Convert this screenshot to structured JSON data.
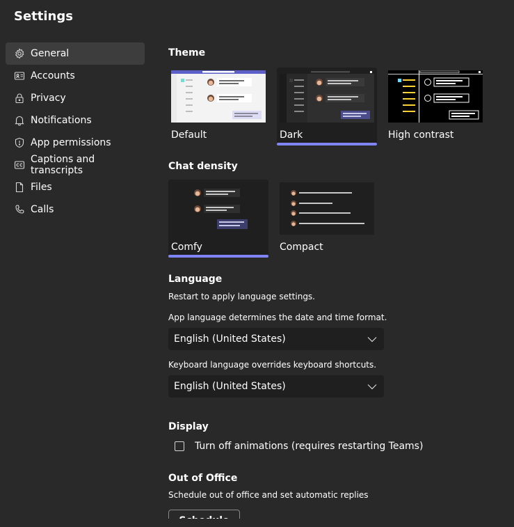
{
  "page_title": "Settings",
  "sidebar": {
    "items": [
      {
        "label": "General",
        "icon": "gear-icon",
        "active": true
      },
      {
        "label": "Accounts",
        "icon": "id-card-icon"
      },
      {
        "label": "Privacy",
        "icon": "lock-icon"
      },
      {
        "label": "Notifications",
        "icon": "bell-icon"
      },
      {
        "label": "App permissions",
        "icon": "shield-icon"
      },
      {
        "label": "Captions and transcripts",
        "icon": "cc-icon"
      },
      {
        "label": "Files",
        "icon": "file-icon"
      },
      {
        "label": "Calls",
        "icon": "phone-icon"
      }
    ]
  },
  "theme": {
    "title": "Theme",
    "options": [
      {
        "label": "Default",
        "selected": false
      },
      {
        "label": "Dark",
        "selected": true
      },
      {
        "label": "High contrast",
        "selected": false
      }
    ]
  },
  "density": {
    "title": "Chat density",
    "options": [
      {
        "label": "Comfy",
        "selected": true
      },
      {
        "label": "Compact",
        "selected": false
      }
    ]
  },
  "language": {
    "title": "Language",
    "restart_note": "Restart to apply language settings.",
    "app_caption": "App language determines the date and time format.",
    "app_value": "English (United States)",
    "keyboard_caption": "Keyboard language overrides keyboard shortcuts.",
    "keyboard_value": "English (United States)"
  },
  "display": {
    "title": "Display",
    "animations_label": "Turn off animations (requires restarting Teams)",
    "animations_checked": false
  },
  "out_of_office": {
    "title": "Out of Office",
    "caption": "Schedule out of office and set automatic replies",
    "button_label": "Schedule"
  },
  "colors": {
    "background": "#292929",
    "accent": "#7f85f5",
    "active_nav": "#3d3d3d",
    "input_bg": "#1f1f1f"
  }
}
